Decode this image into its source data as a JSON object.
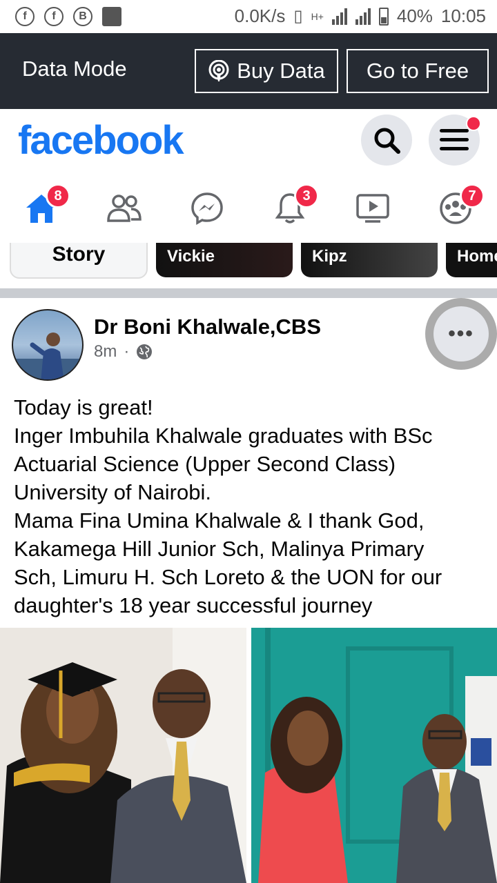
{
  "status_bar": {
    "speed": "0.0K/s",
    "network": "H+",
    "battery": "40%",
    "time": "10:05",
    "icons": [
      "facebook-notif-icon",
      "facebook-notif-icon",
      "b-app-icon",
      "image-icon"
    ]
  },
  "data_mode": {
    "title": "Data Mode",
    "buy_label": "Buy Data",
    "free_label": "Go to Free"
  },
  "header": {
    "logo": "facebook",
    "brand_color": "#1877f2"
  },
  "tabs": {
    "home_badge": "8",
    "notifications_badge": "3",
    "groups_badge": "7"
  },
  "stories": {
    "create_label": "Story",
    "cards": [
      "Vickie",
      "Kipz",
      "Home"
    ]
  },
  "post": {
    "author": "Dr Boni Khalwale,CBS",
    "time": "8m",
    "separator": "·",
    "more": "•••",
    "lines": [
      "Today is great!",
      "Inger Imbuhila Khalwale graduates with BSc",
      "Actuarial Science (Upper Second Class)",
      "University of Nairobi.",
      "Mama Fina Umina Khalwale & I thank God,",
      "Kakamega Hill Junior Sch, Malinya Primary",
      "Sch, Limuru H. Sch Loreto & the UON for our",
      "daughter's 18 year successful journey"
    ]
  }
}
